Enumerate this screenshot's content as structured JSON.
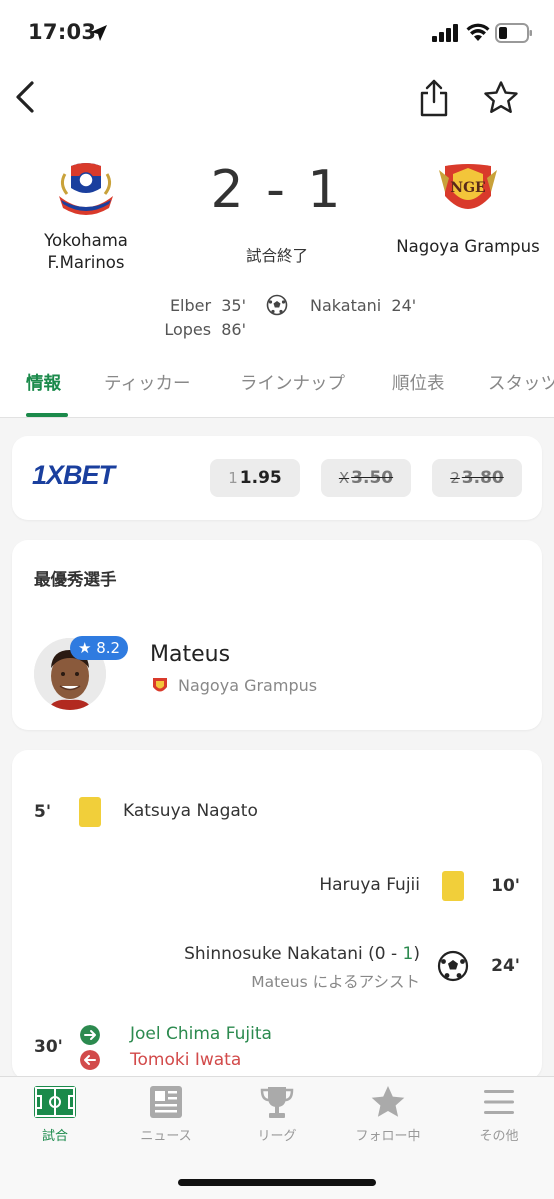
{
  "status_bar": {
    "time": "17:03"
  },
  "match": {
    "home": {
      "name": "Yokohama F.Marinos",
      "line1": "Yokohama",
      "line2": "F.Marinos",
      "crest_text": "Yokohama F·Marinos",
      "color": "#1a3f9e"
    },
    "away": {
      "name": "Nagoya Grampus",
      "crest_text": "NGE",
      "color": "#d93a2b"
    },
    "score": "2 - 1",
    "status": "試合終了",
    "home_scorers": [
      "Elber  35'",
      "Lopes  86'"
    ],
    "away_scorers": [
      "Nakatani  24'"
    ]
  },
  "tabs": [
    "情報",
    "ティッカー",
    "ラインナップ",
    "順位表",
    "スタッツ"
  ],
  "odds": {
    "brand": "1XBET",
    "items": [
      {
        "label": "1",
        "value": "1.95",
        "struck": false
      },
      {
        "label": "X",
        "value": "3.50",
        "struck": true
      },
      {
        "label": "2",
        "value": "3.80",
        "struck": true
      }
    ]
  },
  "mvp": {
    "title": "最優秀選手",
    "rating": "8.2",
    "name": "Mateus",
    "team": "Nagoya Grampus"
  },
  "events": [
    {
      "minute": "5'",
      "side": "home",
      "type": "yellow-card",
      "player": "Katsuya Nagato"
    },
    {
      "minute": "10'",
      "side": "away",
      "type": "yellow-card",
      "player": "Haruya Fujii"
    },
    {
      "minute": "24'",
      "side": "away",
      "type": "goal",
      "player": "Shinnosuke Nakatani",
      "score_prefix": "(0 - ",
      "score_goal": "1",
      "score_suffix": ")",
      "assist": "Mateus によるアシスト"
    },
    {
      "minute": "30'",
      "side": "home",
      "type": "substitution",
      "player_in": "Joel Chima Fujita",
      "player_out": "Tomoki Iwata"
    }
  ],
  "bottom_nav": [
    {
      "label": "試合",
      "icon": "pitch-icon",
      "active": true
    },
    {
      "label": "ニュース",
      "icon": "news-icon",
      "active": false
    },
    {
      "label": "リーグ",
      "icon": "trophy-icon",
      "active": false
    },
    {
      "label": "フォロー中",
      "icon": "star-icon",
      "active": false
    },
    {
      "label": "その他",
      "icon": "menu-icon",
      "active": false
    }
  ],
  "colors": {
    "accent": "#1b8a4b",
    "yellow_card": "#f1cf3a",
    "rating_badge": "#2f7be0",
    "sub_in": "#2c8a4f",
    "sub_out": "#d24a4a"
  }
}
